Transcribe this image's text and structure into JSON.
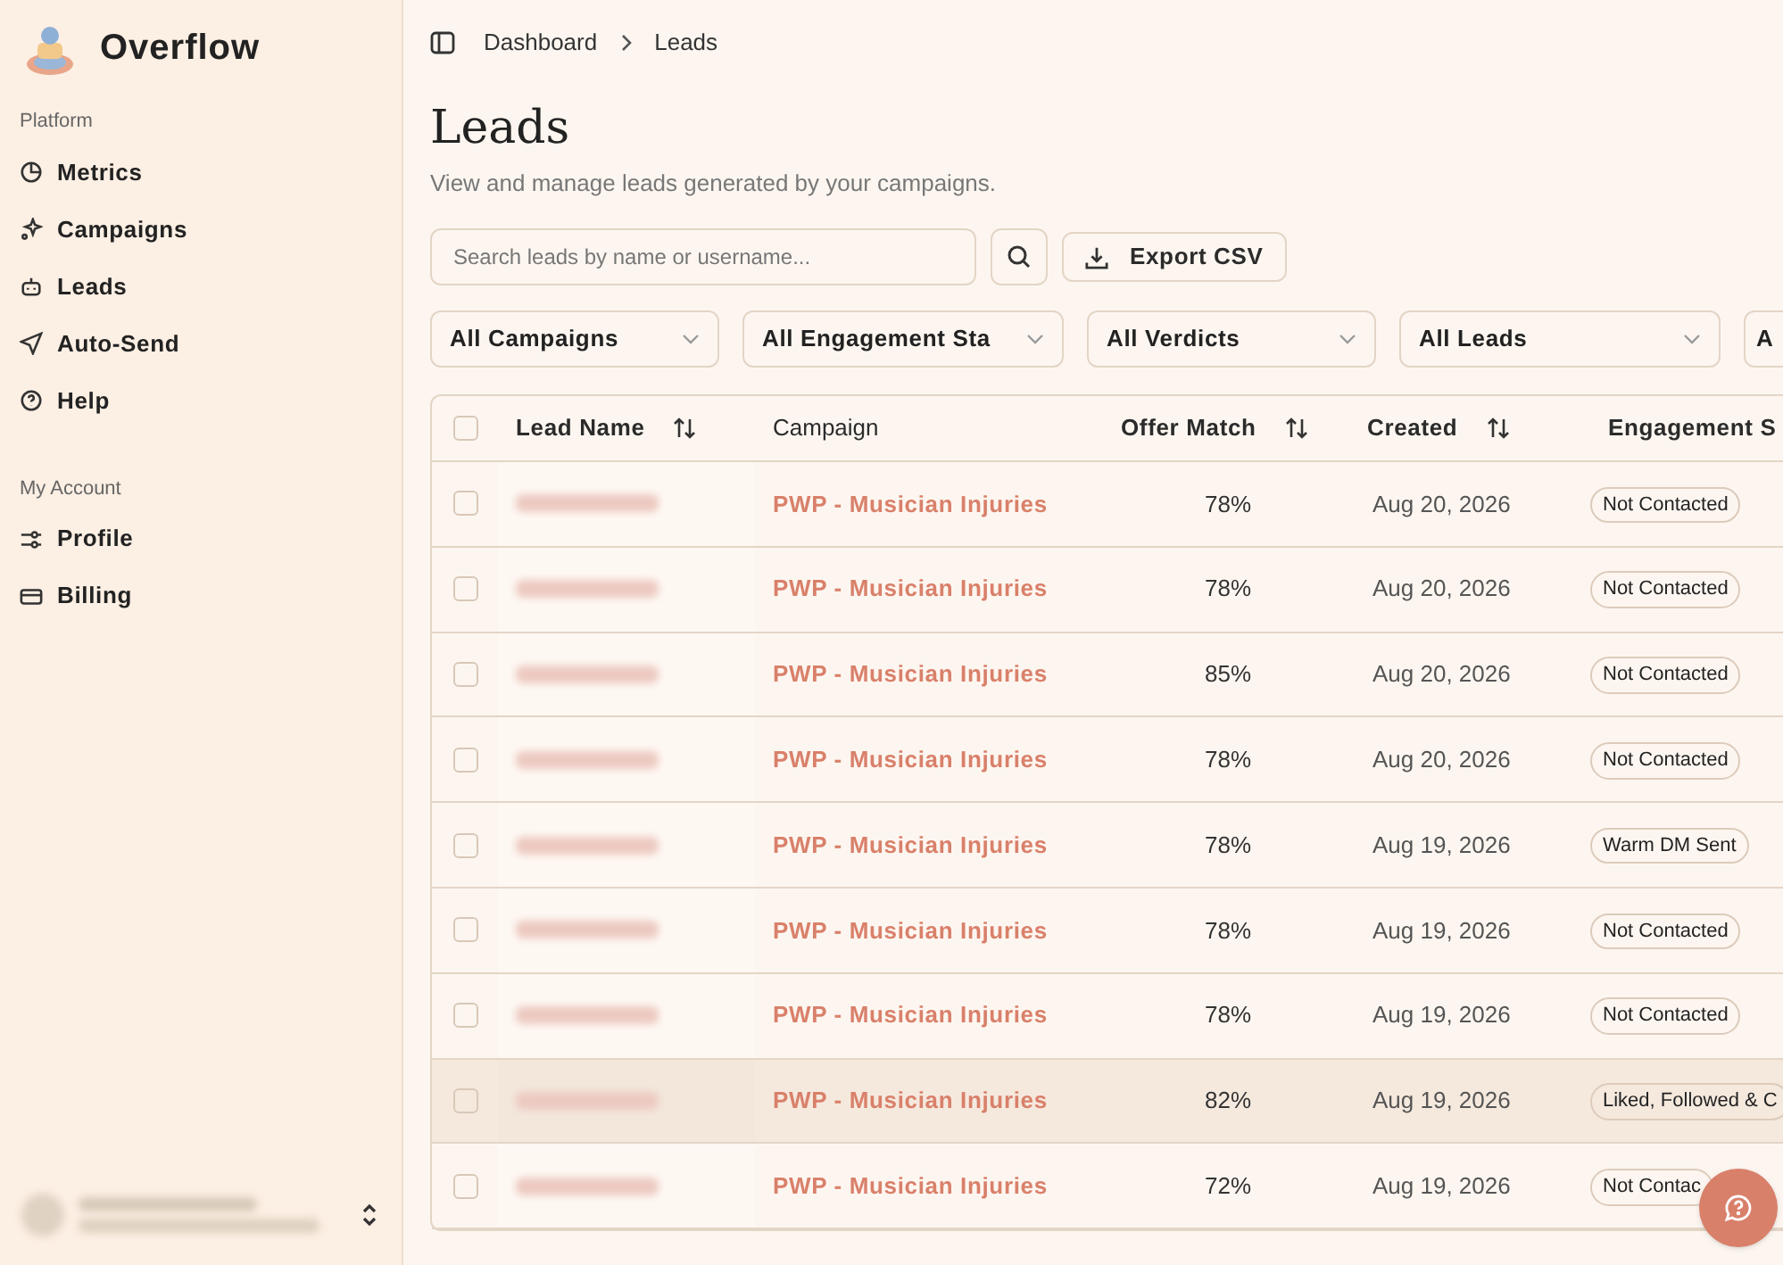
{
  "sidebar": {
    "brand": "Overflow",
    "sections": [
      {
        "heading": "Platform",
        "items": [
          {
            "label": "Metrics"
          },
          {
            "label": "Campaigns"
          },
          {
            "label": "Leads"
          },
          {
            "label": "Auto-Send"
          },
          {
            "label": "Help"
          }
        ]
      },
      {
        "heading": "My Account",
        "items": [
          {
            "label": "Profile"
          },
          {
            "label": "Billing"
          }
        ]
      }
    ]
  },
  "breadcrumb": [
    "Dashboard",
    "Leads"
  ],
  "page": {
    "title": "Leads",
    "subtitle": "View and manage leads generated by your campaigns."
  },
  "search": {
    "placeholder": "Search leads by name or username..."
  },
  "export_button": "Export CSV",
  "filters": [
    "All Campaigns",
    "All Engagement Sta",
    "All Verdicts",
    "All Leads",
    "A"
  ],
  "table": {
    "all_checked": false,
    "columns": [
      {
        "label": "Lead Name",
        "sortable": true
      },
      {
        "label": "Campaign",
        "sortable": false
      },
      {
        "label": "Offer Match",
        "sortable": true
      },
      {
        "label": "Created",
        "sortable": true
      },
      {
        "label": "Engagement S"
      }
    ],
    "rows": [
      {
        "checked": false,
        "hovered": false,
        "campaign": "PWP - Musician Injuries",
        "offer_match": "78%",
        "created": "Aug 20, 2026",
        "engagement": "Not Contacted"
      },
      {
        "checked": false,
        "hovered": false,
        "campaign": "PWP - Musician Injuries",
        "offer_match": "78%",
        "created": "Aug 20, 2026",
        "engagement": "Not Contacted"
      },
      {
        "checked": false,
        "hovered": false,
        "campaign": "PWP - Musician Injuries",
        "offer_match": "85%",
        "created": "Aug 20, 2026",
        "engagement": "Not Contacted"
      },
      {
        "checked": false,
        "hovered": false,
        "campaign": "PWP - Musician Injuries",
        "offer_match": "78%",
        "created": "Aug 20, 2026",
        "engagement": "Not Contacted"
      },
      {
        "checked": false,
        "hovered": false,
        "campaign": "PWP - Musician Injuries",
        "offer_match": "78%",
        "created": "Aug 19, 2026",
        "engagement": "Warm DM Sent"
      },
      {
        "checked": false,
        "hovered": false,
        "campaign": "PWP - Musician Injuries",
        "offer_match": "78%",
        "created": "Aug 19, 2026",
        "engagement": "Not Contacted"
      },
      {
        "checked": false,
        "hovered": false,
        "campaign": "PWP - Musician Injuries",
        "offer_match": "78%",
        "created": "Aug 19, 2026",
        "engagement": "Not Contacted"
      },
      {
        "checked": false,
        "hovered": true,
        "campaign": "PWP - Musician Injuries",
        "offer_match": "82%",
        "created": "Aug 19, 2026",
        "engagement": "Liked, Followed & C"
      },
      {
        "checked": false,
        "hovered": false,
        "campaign": "PWP - Musician Injuries",
        "offer_match": "72%",
        "created": "Aug 19, 2026",
        "engagement": "Not Contac"
      }
    ]
  }
}
